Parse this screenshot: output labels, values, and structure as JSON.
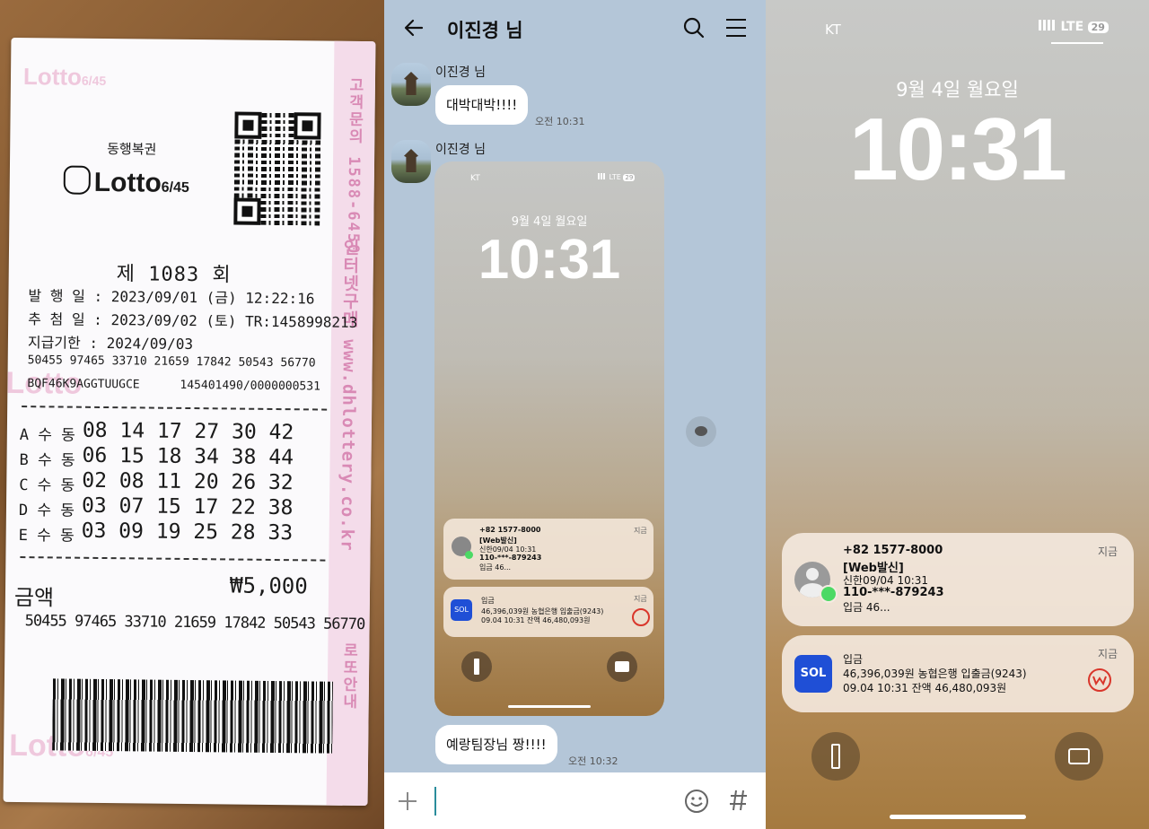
{
  "ticket": {
    "wm_top": "Lotto",
    "wm_top_sub": "6/45",
    "wm_mid": "Lotto",
    "wm_bottom": "Lotto",
    "wm_bottom_sub": "6/45",
    "stripe_phone": "고객문의 1588-6450",
    "stripe_site": "인터넷구매 www.dhlottery.co.kr",
    "stripe_bottom": "로또안내",
    "brand_small": "동행복권",
    "brand_logo": "Lotto",
    "brand_logo_sub": "6/45",
    "round": "제 1083 회",
    "issue_date": "발 행 일 : 2023/09/01 (금) 12:22:16",
    "draw_date": "추 첨 일 : 2023/09/02 (토) TR:1458998213",
    "pay_deadline": "지급기한 : 2024/09/03",
    "serial1": "50455 97465 33710 21659 17842 50543 56770",
    "serial2_left": "BQF46K9AGGTUUGCE",
    "serial2_right": "145401490/0000000531",
    "rows": [
      {
        "label": "A 수 동",
        "nums": "08  14  17  27  30  42"
      },
      {
        "label": "B 수 동",
        "nums": "06  15  18  34  38  44"
      },
      {
        "label": "C 수 동",
        "nums": "02  08  11  20  26  32"
      },
      {
        "label": "D 수 동",
        "nums": "03  07  15  17  22  38"
      },
      {
        "label": "E 수 동",
        "nums": "03  09  19  25  28  33"
      }
    ],
    "amount_label": "금액",
    "amount_value": "₩5,000",
    "serial_bottom": "50455 97465 33710 21659 17842 50543 56770"
  },
  "chat": {
    "title": "이진경 님",
    "messages": [
      {
        "sender": "이진경 님",
        "text": "대박대박!!!!",
        "time": "오전 10:31"
      },
      {
        "sender": "이진경 님"
      },
      {
        "text": "예랑팀장님 짱!!!!",
        "time": "오전 10:32"
      }
    ]
  },
  "lockscreen": {
    "carrier": "KT",
    "network": "LTE",
    "battery": "29",
    "date": "9월 4일 월요일",
    "time": "10:31",
    "notif1": {
      "from": "+82 1577-8000",
      "when": "지금",
      "l1": "[Web발신]",
      "l2": "신한09/04  10:31",
      "l3": "110-***-879243",
      "l4": "입금        46..."
    },
    "notif2": {
      "app": "SOL",
      "when": "지금",
      "l1": "입금",
      "l2": "46,396,039원 농협은행 입출금(9243)",
      "l3": "09.04 10:31 잔액 46,480,093원"
    }
  },
  "colors": {
    "chat_bg": "#b4c6d8",
    "ticket_pink": "#d98ab5",
    "sol_blue": "#1f4fd6",
    "woori_red": "#d9362b",
    "msg_green": "#4cd964"
  }
}
